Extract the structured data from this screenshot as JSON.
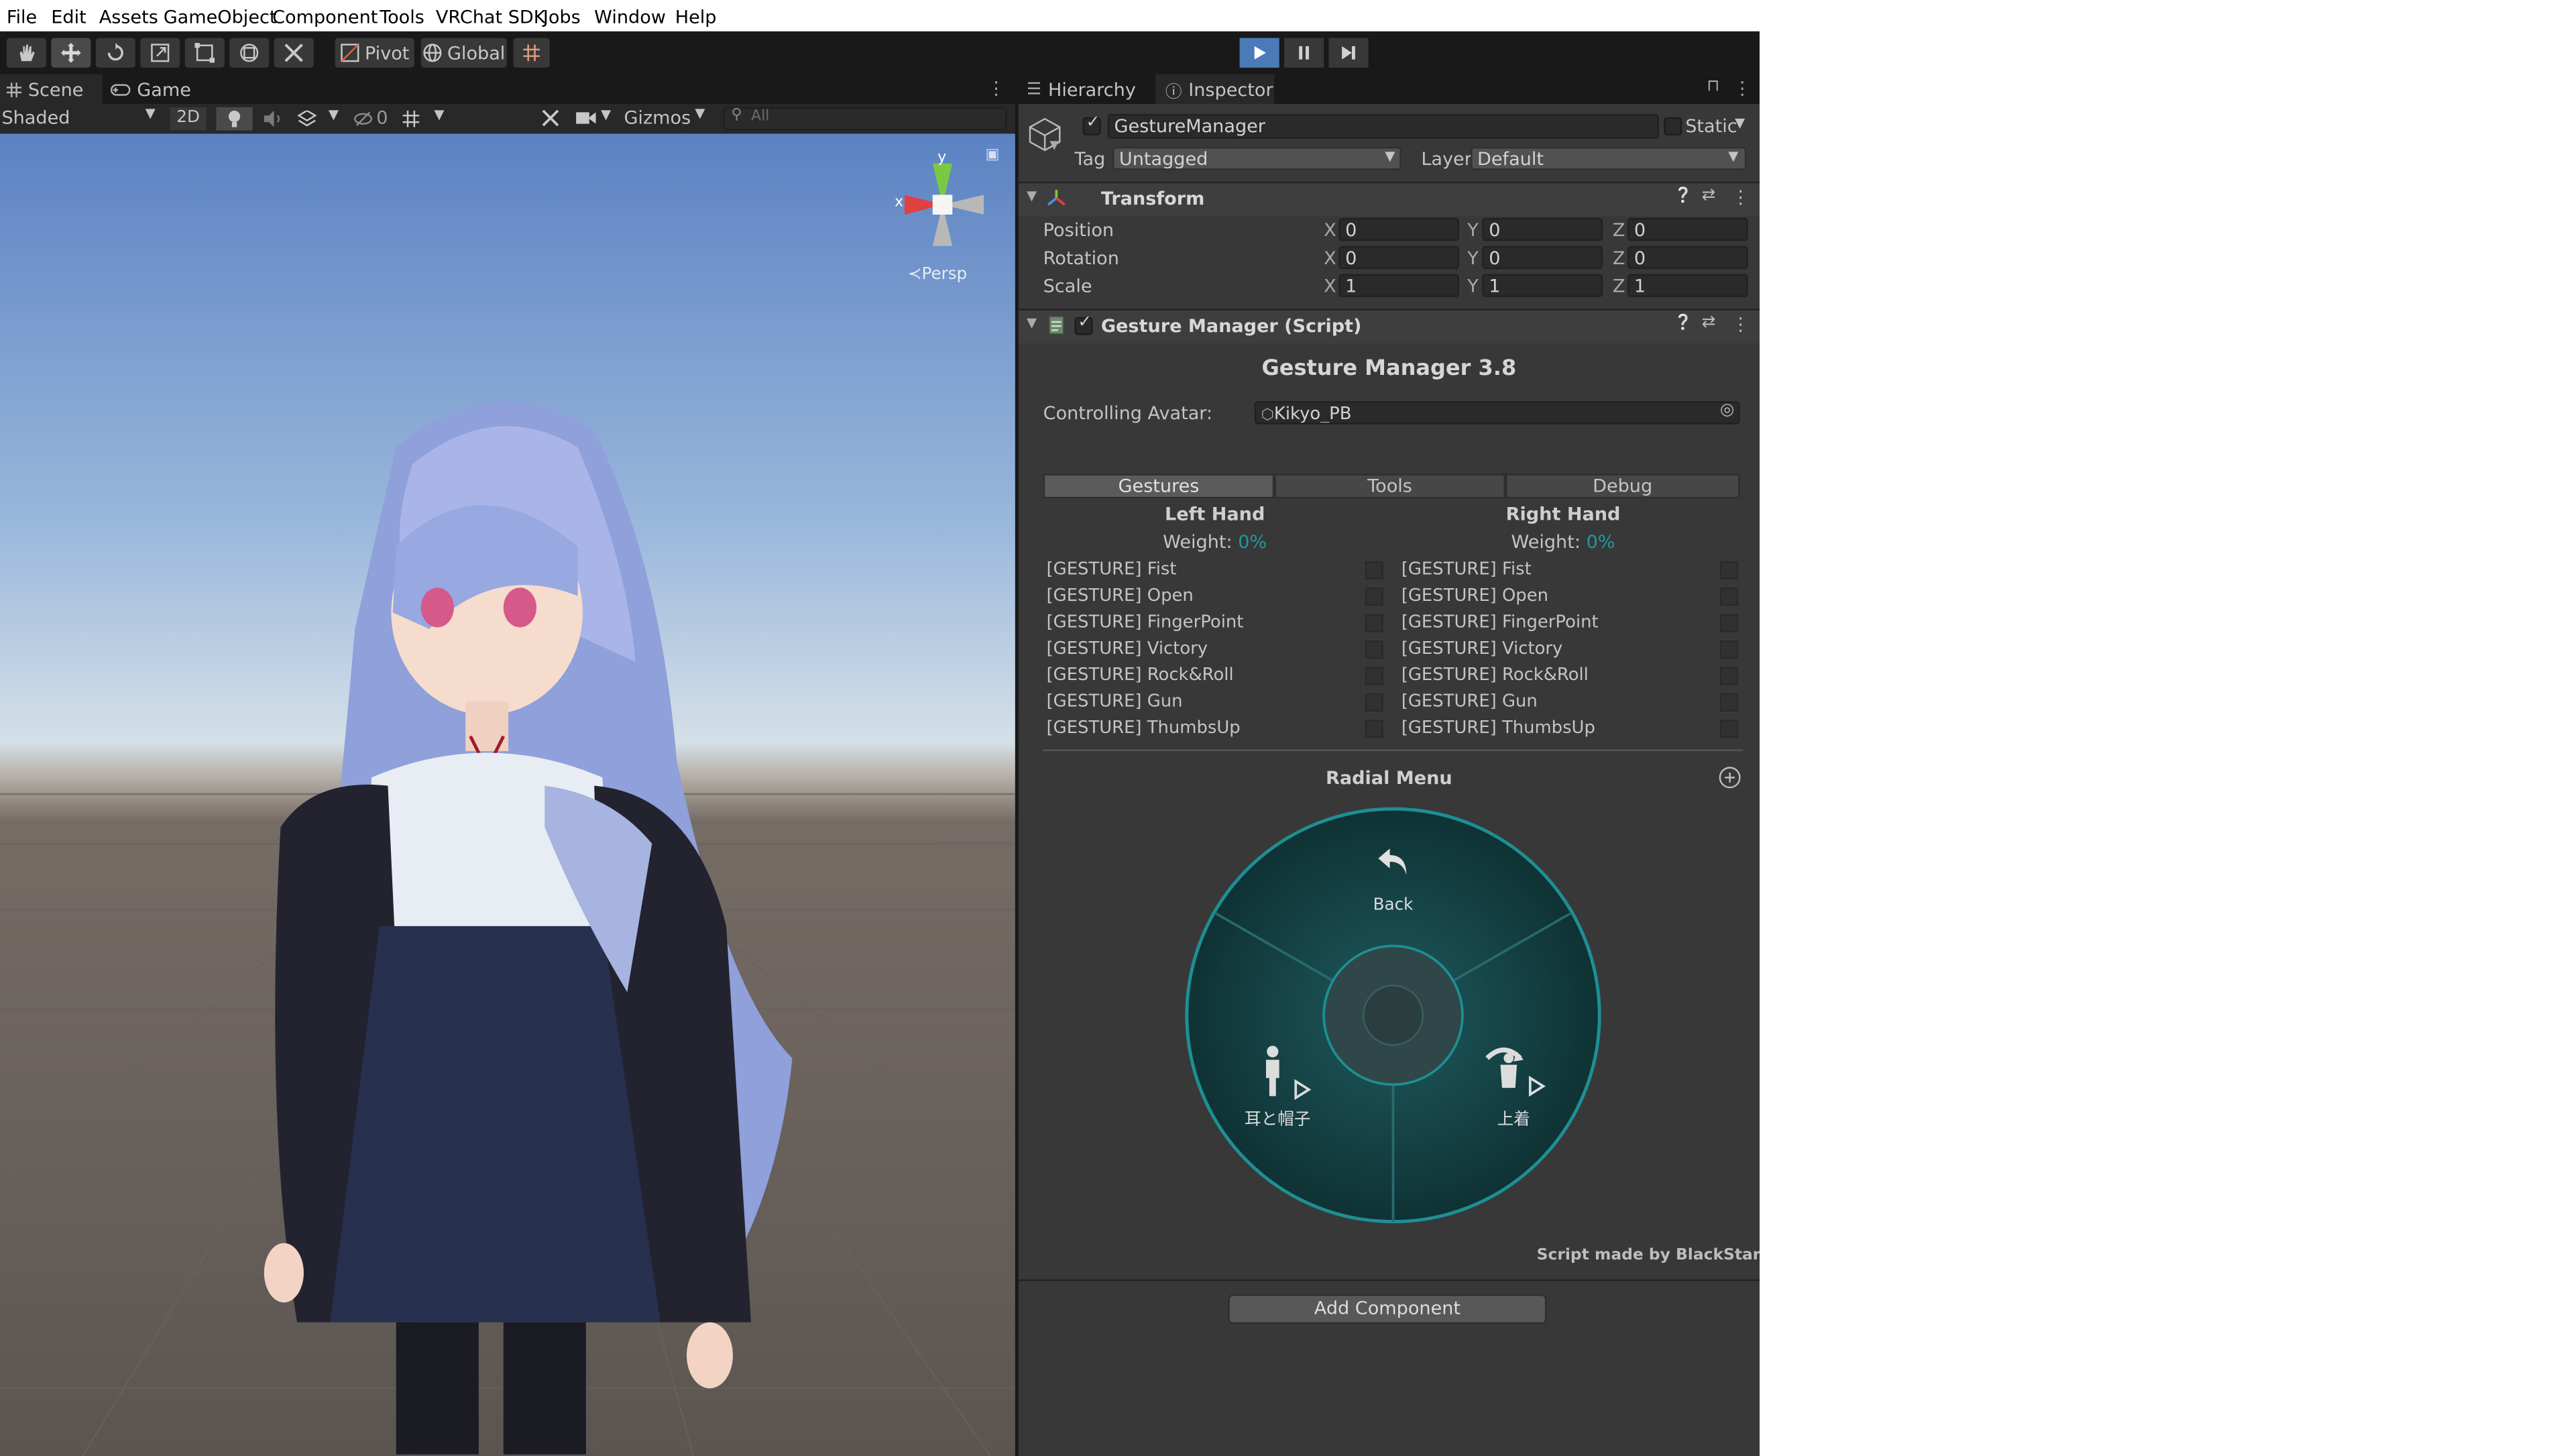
{
  "menu": [
    "File",
    "Edit",
    "Assets",
    "GameObject",
    "Component",
    "Tools",
    "VRChat SDK",
    "Jobs",
    "Window",
    "Help"
  ],
  "toolbar": {
    "pivot_label": "Pivot",
    "global_label": "Global"
  },
  "scene_tabs": {
    "scene": "Scene",
    "game": "Game"
  },
  "scene_toolbar": {
    "shading": "Shaded",
    "mode_2d": "2D",
    "hidden_count": "0",
    "gizmos": "Gizmos",
    "search_placeholder": "All"
  },
  "gizmo": {
    "y": "y",
    "x": "x",
    "persp": "Persp"
  },
  "inspector_tabs": {
    "hierarchy": "Hierarchy",
    "inspector": "Inspector"
  },
  "object": {
    "name": "GestureManager",
    "static_label": "Static",
    "tag_label": "Tag",
    "tag_value": "Untagged",
    "layer_label": "Layer",
    "layer_value": "Default"
  },
  "transform": {
    "title": "Transform",
    "rows": [
      {
        "label": "Position",
        "x": "0",
        "y": "0",
        "z": "0"
      },
      {
        "label": "Rotation",
        "x": "0",
        "y": "0",
        "z": "0"
      },
      {
        "label": "Scale",
        "x": "1",
        "y": "1",
        "z": "1"
      }
    ],
    "axis": {
      "x": "X",
      "y": "Y",
      "z": "Z"
    }
  },
  "script": {
    "title": "Gesture Manager (Script)",
    "heading": "Gesture Manager 3.8",
    "avatar_label": "Controlling Avatar:",
    "avatar_value": "Kikyo_PB",
    "tabs": [
      "Gestures",
      "Tools",
      "Debug"
    ],
    "left": {
      "title": "Left Hand",
      "weight_label": "Weight:",
      "weight_value": "0%"
    },
    "right": {
      "title": "Right Hand",
      "weight_label": "Weight:",
      "weight_value": "0%"
    },
    "gestures": [
      "[GESTURE] Fist",
      "[GESTURE] Open",
      "[GESTURE] FingerPoint",
      "[GESTURE] Victory",
      "[GESTURE] Rock&Roll",
      "[GESTURE] Gun",
      "[GESTURE] ThumbsUp"
    ],
    "radial_title": "Radial Menu",
    "radial": {
      "back": "Back",
      "item_left": "耳と帽子",
      "item_right": "上着"
    },
    "footer": "Script made by BlackStartx"
  },
  "add_component": "Add Component",
  "colors": {
    "accent_teal": "#1d9ba0",
    "play_blue": "#4a9de8",
    "editor_bg": "#383838"
  }
}
